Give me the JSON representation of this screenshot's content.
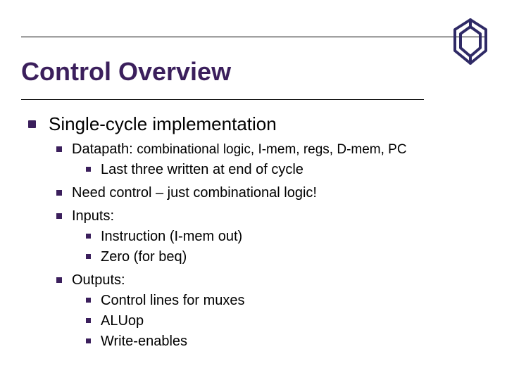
{
  "title": "Control Overview",
  "logo_name": "institution-logo",
  "body": {
    "lvl1": "Single-cycle implementation",
    "items": [
      {
        "text_a": "Datapath: ",
        "text_b": "combinational logic, I-mem, regs, D-mem, PC",
        "sub": [
          "Last three written at end of cycle"
        ]
      },
      {
        "text_a": "Need control – just combinational logic!",
        "text_b": "",
        "sub": []
      },
      {
        "text_a": "Inputs:",
        "text_b": "",
        "sub": [
          "Instruction (I-mem out)",
          "Zero (for beq)"
        ]
      },
      {
        "text_a": "Outputs:",
        "text_b": "",
        "sub": [
          "Control lines for muxes",
          "ALUop",
          "Write-enables"
        ]
      }
    ]
  }
}
